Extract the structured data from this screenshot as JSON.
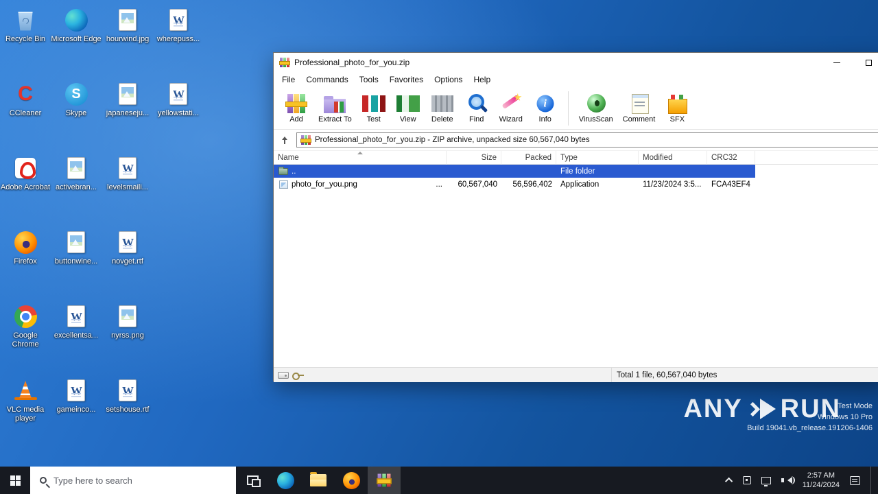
{
  "desktop": {
    "icons": [
      {
        "name": "recycle-bin",
        "label": "Recycle Bin",
        "kind": "recycle",
        "col": 0,
        "row": 0
      },
      {
        "name": "microsoft-edge",
        "label": "Microsoft Edge",
        "kind": "edge",
        "col": 1,
        "row": 0
      },
      {
        "name": "hourwind",
        "label": "hourwind.jpg",
        "kind": "image",
        "col": 2,
        "row": 0
      },
      {
        "name": "wherepuss",
        "label": "wherepuss...",
        "kind": "word",
        "col": 3,
        "row": 0
      },
      {
        "name": "ccleaner",
        "label": "CCleaner",
        "kind": "ccleaner",
        "col": 0,
        "row": 1
      },
      {
        "name": "skype",
        "label": "Skype",
        "kind": "skype",
        "col": 1,
        "row": 1
      },
      {
        "name": "japaneseju",
        "label": "japaneseju...",
        "kind": "image",
        "col": 2,
        "row": 1
      },
      {
        "name": "yellowstati",
        "label": "yellowstati...",
        "kind": "word",
        "col": 3,
        "row": 1
      },
      {
        "name": "adobe-acrobat",
        "label": "Adobe Acrobat",
        "kind": "acrobat",
        "col": 0,
        "row": 2
      },
      {
        "name": "activebran",
        "label": "activebran...",
        "kind": "image",
        "col": 1,
        "row": 2
      },
      {
        "name": "levelsmaili",
        "label": "levelsmaili...",
        "kind": "word",
        "col": 2,
        "row": 2
      },
      {
        "name": "firefox",
        "label": "Firefox",
        "kind": "firefox",
        "col": 0,
        "row": 3
      },
      {
        "name": "buttonwine",
        "label": "buttonwine...",
        "kind": "image",
        "col": 1,
        "row": 3
      },
      {
        "name": "novget",
        "label": "novget.rtf",
        "kind": "word",
        "col": 2,
        "row": 3
      },
      {
        "name": "google-chrome",
        "label": "Google Chrome",
        "kind": "chrome",
        "col": 0,
        "row": 4
      },
      {
        "name": "excellentsa",
        "label": "excellentsa...",
        "kind": "word",
        "col": 1,
        "row": 4
      },
      {
        "name": "nyrss",
        "label": "nyrss.png",
        "kind": "image",
        "col": 2,
        "row": 4
      },
      {
        "name": "vlc",
        "label": "VLC media player",
        "kind": "vlc",
        "col": 0,
        "row": 5
      },
      {
        "name": "gameinco",
        "label": "gameinco...",
        "kind": "word",
        "col": 1,
        "row": 5
      },
      {
        "name": "setshouse",
        "label": "setshouse.rtf",
        "kind": "word",
        "col": 2,
        "row": 5
      }
    ]
  },
  "winrar": {
    "title": "Professional_photo_for_you.zip",
    "menu": [
      "File",
      "Commands",
      "Tools",
      "Favorites",
      "Options",
      "Help"
    ],
    "toolbar": [
      {
        "label": "Add",
        "icon": "add"
      },
      {
        "label": "Extract To",
        "icon": "extract"
      },
      {
        "label": "Test",
        "icon": "test"
      },
      {
        "label": "View",
        "icon": "view"
      },
      {
        "label": "Delete",
        "icon": "delete"
      },
      {
        "label": "Find",
        "icon": "find"
      },
      {
        "label": "Wizard",
        "icon": "wizard"
      },
      {
        "label": "Info",
        "icon": "info"
      },
      {
        "label": "VirusScan",
        "icon": "virusscan",
        "separator_before": true
      },
      {
        "label": "Comment",
        "icon": "comment"
      },
      {
        "label": "SFX",
        "icon": "sfx"
      }
    ],
    "address": "Professional_photo_for_you.zip - ZIP archive, unpacked size 60,567,040 bytes",
    "columns": [
      "Name",
      "Size",
      "Packed",
      "Type",
      "Modified",
      "CRC32"
    ],
    "rows": [
      {
        "icon": "folder-up",
        "name": "..",
        "name_suffix": "",
        "size": "",
        "packed": "",
        "type": "File folder",
        "modified": "",
        "crc": "",
        "selected": true
      },
      {
        "icon": "app-file",
        "name": "photo_for_you.png",
        "name_suffix": "...",
        "size": "60,567,040",
        "packed": "56,596,402",
        "type": "Application",
        "modified": "11/23/2024 3:5...",
        "crc": "FCA43EF4",
        "selected": false
      }
    ],
    "status_total": "Total 1 file, 60,567,040 bytes"
  },
  "taskbar": {
    "search_placeholder": "Type here to search",
    "time": "2:57 AM",
    "date": "11/24/2024"
  },
  "watermark": {
    "brand_left": "ANY",
    "brand_right": "RUN",
    "line1": "Test Mode",
    "line2": "Windows 10 Pro",
    "line3": "Build 19041.vb_release.191206-1406"
  }
}
